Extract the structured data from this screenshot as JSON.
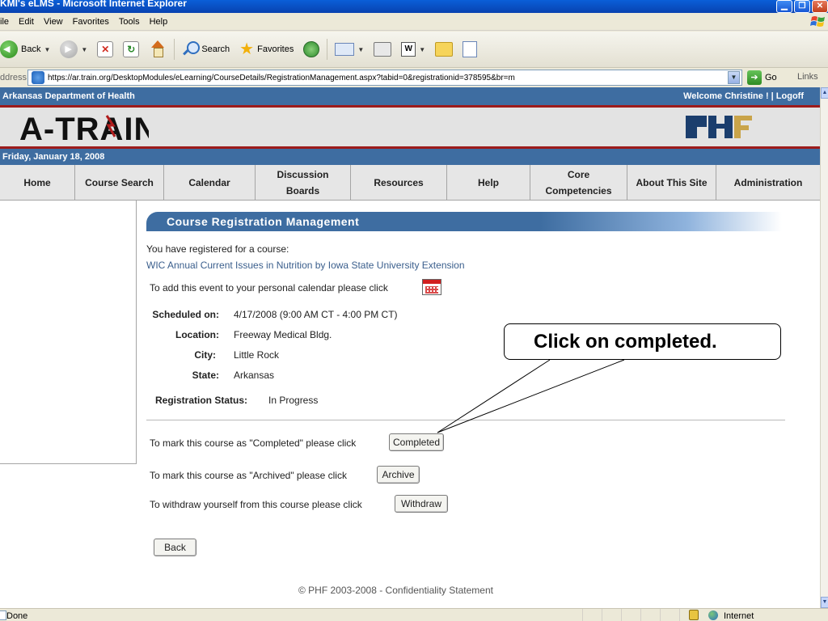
{
  "window": {
    "title": "KMI's eLMS - Microsoft Internet Explorer"
  },
  "menu": [
    "ile",
    "Edit",
    "View",
    "Favorites",
    "Tools",
    "Help"
  ],
  "toolbar": {
    "back_label": "Back",
    "search_label": "Search",
    "favorites_label": "Favorites"
  },
  "address": {
    "label": "ddress",
    "url": "https://ar.train.org/DesktopModules/eLearning/CourseDetails/RegistrationManagement.aspx?tabid=0&registrationid=378595&br=m",
    "go_label": "Go",
    "links_label": "Links"
  },
  "site": {
    "org": "Arkansas Department of Health",
    "welcome": "Welcome Christine ! | Logoff",
    "logo": "A-TRAIN",
    "date": "Friday, January 18, 2008"
  },
  "nav": [
    {
      "label": "Home"
    },
    {
      "label": "Course Search"
    },
    {
      "label": "Calendar"
    },
    {
      "label": "Discussion Boards"
    },
    {
      "label": "Resources"
    },
    {
      "label": "Help"
    },
    {
      "label": "Core Competencies"
    },
    {
      "label": "About This Site"
    },
    {
      "label": "Administration"
    }
  ],
  "main": {
    "heading": "Course Registration Management",
    "registered_text": "You have registered for a course:",
    "course_title": "WIC Annual Current Issues in Nutrition by Iowa State University Extension",
    "calendar_text": "To add this event to your personal calendar please click",
    "details": {
      "scheduled_label": "Scheduled on:",
      "scheduled_value": "4/17/2008 (9:00 AM CT - 4:00 PM CT)",
      "location_label": "Location:",
      "location_value": "Freeway Medical Bldg.",
      "city_label": "City:",
      "city_value": "Little Rock",
      "state_label": "State:",
      "state_value": "Arkansas",
      "status_label": "Registration Status:",
      "status_value": "In Progress"
    },
    "completed_text": "To mark this course as \"Completed\" please click",
    "completed_button": "Completed",
    "archived_text": "To mark this course as \"Archived\" please click",
    "archive_button": "Archive",
    "withdraw_text": "To withdraw yourself from this course please click",
    "withdraw_button": "Withdraw",
    "back_button": "Back"
  },
  "callout": {
    "text": "Click on completed."
  },
  "footer": {
    "text": "© PHF 2003-2008 - Confidentiality Statement"
  },
  "status": {
    "text": "Done",
    "zone": "Internet"
  },
  "colors": {
    "site_blue": "#3e6da1",
    "site_red": "#9d1b1b",
    "link": "#3a5e8c"
  }
}
